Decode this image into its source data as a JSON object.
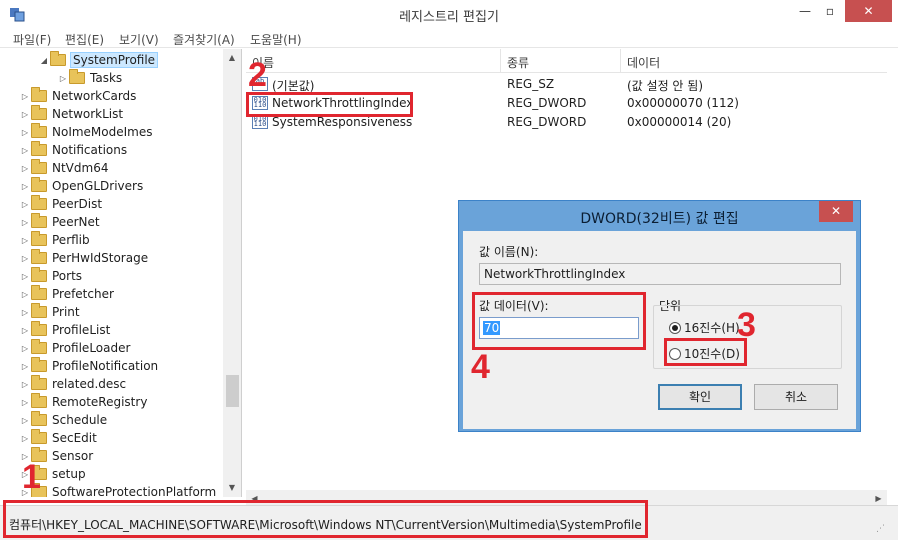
{
  "window": {
    "title": "레지스트리 편집기",
    "min_glyph": "—",
    "max_glyph": "▫",
    "close_glyph": "✕"
  },
  "menu": [
    "파일(F)",
    "편집(E)",
    "보기(V)",
    "즐겨찾기(A)",
    "도움말(H)"
  ],
  "tree": {
    "selected": "SystemProfile",
    "child": "Tasks",
    "items": [
      "NetworkCards",
      "NetworkList",
      "NoImeModeImes",
      "Notifications",
      "NtVdm64",
      "OpenGLDrivers",
      "PeerDist",
      "PeerNet",
      "Perflib",
      "PerHwIdStorage",
      "Ports",
      "Prefetcher",
      "Print",
      "ProfileList",
      "ProfileLoader",
      "ProfileNotification",
      "related.desc",
      "RemoteRegistry",
      "Schedule",
      "SecEdit",
      "Sensor",
      "setup",
      "SoftwareProtectionPlatform"
    ]
  },
  "list": {
    "columns": [
      "이름",
      "종류",
      "데이터"
    ],
    "rows": [
      {
        "name": "(기본값)",
        "type": "REG_SZ",
        "data": "(값 설정 안 됨)",
        "icon": "ab-string-icon"
      },
      {
        "name": "NetworkThrottlingIndex",
        "type": "REG_DWORD",
        "data": "0x00000070 (112)",
        "icon": "dword-icon"
      },
      {
        "name": "SystemResponsiveness",
        "type": "REG_DWORD",
        "data": "0x00000014 (20)",
        "icon": "dword-icon"
      }
    ]
  },
  "status": {
    "path": "컴퓨터\\HKEY_LOCAL_MACHINE\\SOFTWARE\\Microsoft\\Windows NT\\CurrentVersion\\Multimedia\\SystemProfile"
  },
  "dialog": {
    "title": "DWORD(32비트) 값 편집",
    "name_label": "값 이름(N):",
    "name_value": "NetworkThrottlingIndex",
    "data_label": "값 데이터(V):",
    "data_value": "70",
    "base_label": "단위",
    "base_hex": "16진수(H)",
    "base_dec": "10진수(D)",
    "base_selected": "hex",
    "ok": "확인",
    "cancel": "취소"
  },
  "annotations": {
    "one": "1",
    "two": "2",
    "three": "3",
    "four": "4",
    "color": "#e0262f"
  },
  "colors": {
    "accent": "#6aa3d9",
    "close": "#c75050",
    "selection": "#3399ff",
    "folder": "#e8c35a"
  }
}
